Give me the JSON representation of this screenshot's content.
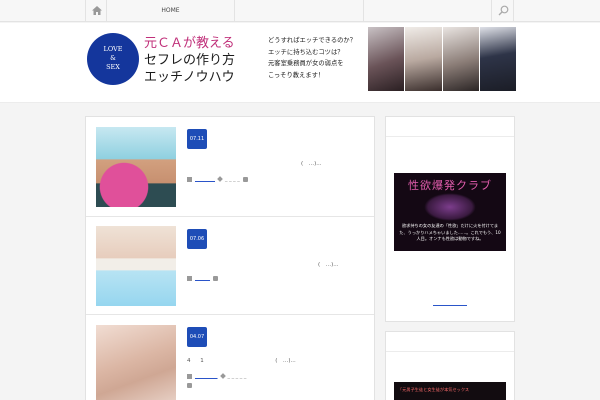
{
  "nav": {
    "home_icon": "home-icon",
    "home_label": "HOME",
    "search_icon": "search-icon"
  },
  "header": {
    "logo_line1": "LOVE",
    "logo_line2": "&",
    "logo_line3": "SEX",
    "title_line1": "元ＣＡが教える",
    "title_line2": "セフレの作り方",
    "title_line3": "エッチノウハウ",
    "tagline_lines": [
      "どうすればエッチできるのか？",
      "エッチに持ち込むコツは？",
      "元客室乗務員が女の弱点を",
      "こっそり教えます！"
    ]
  },
  "posts": [
    {
      "date": "07.11",
      "excerpt_prefix": "",
      "excerpt_suffix": "(　…)...",
      "category": "________",
      "tags": "_ _ _ _",
      "comment_icon": "comment-icon"
    },
    {
      "date": "07.06",
      "excerpt_prefix": "",
      "excerpt_suffix": "(　…)...",
      "category": "______",
      "tags": "",
      "comment_icon": "comment-icon"
    },
    {
      "date": "04.07",
      "excerpt_prefix": "4 1",
      "excerpt_suffix": "(　…)...",
      "category": "_________",
      "tags": "_ _ _ _ _",
      "comment_icon": "comment-icon"
    }
  ],
  "sidebar": {
    "banner1_title": "性欲爆発クラブ",
    "banner1_text": "欲求持ちの女の友達の「性欲」だけに火を付けてまた、うっかりハメちゃいました……。これでもう、10人目。オンナも性欲は動物ですね。",
    "banner2_text": "「元男子生徒と女生徒が本気セックス"
  },
  "colors": {
    "accent_blue": "#1e4db7",
    "logo_navy": "#14369c",
    "title_pink": "#c0307a"
  }
}
